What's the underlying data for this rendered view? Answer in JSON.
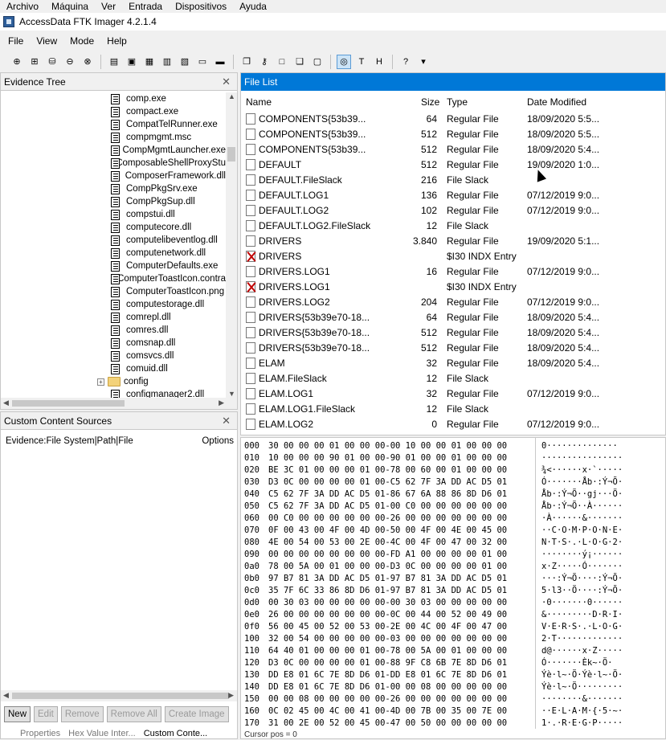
{
  "host_menu": [
    "Archivo",
    "Máquina",
    "Ver",
    "Entrada",
    "Dispositivos",
    "Ayuda"
  ],
  "window": {
    "title": "AccessData FTK Imager 4.2.1.4"
  },
  "menu": [
    "File",
    "View",
    "Mode",
    "Help"
  ],
  "toolbar_icons": [
    "add-evidence-icon",
    "add-all-evidence-icon",
    "image-mounting-icon",
    "remove-evidence-icon",
    "remove-all-icon",
    "create-disk-image-icon",
    "export-disk-image-icon",
    "export-logical-image-icon",
    "add-to-custom-icon",
    "create-custom-image-icon",
    "decrypt-icon",
    "verify-drive-icon",
    "export-files-icon",
    "export-hash-icon",
    "new-document-icon",
    "copy-icon",
    "print-icon",
    "auto-view-icon",
    "text-view-icon",
    "hex-view-icon",
    "help-icon",
    "dropdown-icon"
  ],
  "evidence_tree": {
    "title": "Evidence Tree",
    "items": [
      "comp.exe",
      "compact.exe",
      "CompatTelRunner.exe",
      "compmgmt.msc",
      "CompMgmtLauncher.exe",
      "ComposableShellProxyStu",
      "ComposerFramework.dll",
      "CompPkgSrv.exe",
      "CompPkgSup.dll",
      "compstui.dll",
      "computecore.dll",
      "computelibeventlog.dll",
      "computenetwork.dll",
      "ComputerDefaults.exe",
      "ComputerToastIcon.contra",
      "ComputerToastIcon.png",
      "computestorage.dll",
      "comrepl.dll",
      "comres.dll",
      "comsnap.dll",
      "comsvcs.dll",
      "comuid.dll"
    ],
    "folder": "config",
    "partial": "configmanager2.dll"
  },
  "custom_content": {
    "title": "Custom Content Sources",
    "col_evidence": "Evidence:File System|Path|File",
    "col_options": "Options",
    "buttons": [
      "New",
      "Edit",
      "Remove",
      "Remove All",
      "Create Image"
    ],
    "tabs": [
      "Properties",
      "Hex Value Inter...",
      "Custom Conte..."
    ]
  },
  "file_list": {
    "title": "File List",
    "columns": {
      "name": "Name",
      "size": "Size",
      "type": "Type",
      "date": "Date Modified"
    },
    "rows": [
      {
        "name": "COMPONENTS{53b39...",
        "size": "64",
        "type": "Regular File",
        "date": "18/09/2020 5:5...",
        "deleted": false
      },
      {
        "name": "COMPONENTS{53b39...",
        "size": "512",
        "type": "Regular File",
        "date": "18/09/2020 5:5...",
        "deleted": false
      },
      {
        "name": "COMPONENTS{53b39...",
        "size": "512",
        "type": "Regular File",
        "date": "18/09/2020 5:4...",
        "deleted": false
      },
      {
        "name": "DEFAULT",
        "size": "512",
        "type": "Regular File",
        "date": "19/09/2020 1:0...",
        "deleted": false
      },
      {
        "name": "DEFAULT.FileSlack",
        "size": "216",
        "type": "File Slack",
        "date": "",
        "deleted": false
      },
      {
        "name": "DEFAULT.LOG1",
        "size": "136",
        "type": "Regular File",
        "date": "07/12/2019 9:0...",
        "deleted": false
      },
      {
        "name": "DEFAULT.LOG2",
        "size": "102",
        "type": "Regular File",
        "date": "07/12/2019 9:0...",
        "deleted": false
      },
      {
        "name": "DEFAULT.LOG2.FileSlack",
        "size": "12",
        "type": "File Slack",
        "date": "",
        "deleted": false
      },
      {
        "name": "DRIVERS",
        "size": "3.840",
        "type": "Regular File",
        "date": "19/09/2020 5:1...",
        "deleted": false
      },
      {
        "name": "DRIVERS",
        "size": "",
        "type": "$I30 INDX Entry",
        "date": "",
        "deleted": true
      },
      {
        "name": "DRIVERS.LOG1",
        "size": "16",
        "type": "Regular File",
        "date": "07/12/2019 9:0...",
        "deleted": false
      },
      {
        "name": "DRIVERS.LOG1",
        "size": "",
        "type": "$I30 INDX Entry",
        "date": "",
        "deleted": true
      },
      {
        "name": "DRIVERS.LOG2",
        "size": "204",
        "type": "Regular File",
        "date": "07/12/2019 9:0...",
        "deleted": false
      },
      {
        "name": "DRIVERS{53b39e70-18...",
        "size": "64",
        "type": "Regular File",
        "date": "18/09/2020 5:4...",
        "deleted": false
      },
      {
        "name": "DRIVERS{53b39e70-18...",
        "size": "512",
        "type": "Regular File",
        "date": "18/09/2020 5:4...",
        "deleted": false
      },
      {
        "name": "DRIVERS{53b39e70-18...",
        "size": "512",
        "type": "Regular File",
        "date": "18/09/2020 5:4...",
        "deleted": false
      },
      {
        "name": "ELAM",
        "size": "32",
        "type": "Regular File",
        "date": "18/09/2020 5:4...",
        "deleted": false
      },
      {
        "name": "ELAM.FileSlack",
        "size": "12",
        "type": "File Slack",
        "date": "",
        "deleted": false
      },
      {
        "name": "ELAM.LOG1",
        "size": "32",
        "type": "Regular File",
        "date": "07/12/2019 9:0...",
        "deleted": false
      },
      {
        "name": "ELAM.LOG1.FileSlack",
        "size": "12",
        "type": "File Slack",
        "date": "",
        "deleted": false
      },
      {
        "name": "ELAM.LOG2",
        "size": "0",
        "type": "Regular File",
        "date": "07/12/2019 9:0...",
        "deleted": false
      }
    ]
  },
  "hex": {
    "rows": [
      {
        "off": "000",
        "bytes": "30 00 00 00 01 00 00 00-00 10 00 00 01 00 00 00",
        "ascii": "0··············"
      },
      {
        "off": "010",
        "bytes": "10 00 00 00 90 01 00 00-90 01 00 00 01 00 00 00",
        "ascii": "················"
      },
      {
        "off": "020",
        "bytes": "BE 3C 01 00 00 00 01 00-78 00 60 00 01 00 00 00",
        "ascii": "¾<······x·`·····"
      },
      {
        "off": "030",
        "bytes": "D3 0C 00 00 00 00 01 00-C5 62 7F 3A DD AC D5 01",
        "ascii": "Ó·······Åb·:Ý¬Õ·"
      },
      {
        "off": "040",
        "bytes": "C5 62 7F 3A DD AC D5 01-86 67 6A 88 86 8D D6 01",
        "ascii": "Åb·:Ý¬Õ··gj···Ö·"
      },
      {
        "off": "050",
        "bytes": "C5 62 7F 3A DD AC D5 01-00 C0 00 00 00 00 00 00",
        "ascii": "Åb·:Ý¬Õ··À······"
      },
      {
        "off": "060",
        "bytes": "00 C0 00 00 00 00 00 00-26 00 00 00 00 00 00 00",
        "ascii": "·À······&·······"
      },
      {
        "off": "070",
        "bytes": "0F 00 43 00 4F 00 4D 00-50 00 4F 00 4E 00 45 00",
        "ascii": "··C·O·M·P·O·N·E·"
      },
      {
        "off": "080",
        "bytes": "4E 00 54 00 53 00 2E 00-4C 00 4F 00 47 00 32 00",
        "ascii": "N·T·S·.·L·O·G·2·"
      },
      {
        "off": "090",
        "bytes": "00 00 00 00 00 00 00 00-FD A1 00 00 00 00 01 00",
        "ascii": "········ý¡······"
      },
      {
        "off": "0a0",
        "bytes": "78 00 5A 00 01 00 00 00-D3 0C 00 00 00 00 01 00",
        "ascii": "x·Z·····Ó·······"
      },
      {
        "off": "0b0",
        "bytes": "97 B7 81 3A DD AC D5 01-97 B7 81 3A DD AC D5 01",
        "ascii": "···:Ý¬Õ····:Ý¬Õ·"
      },
      {
        "off": "0c0",
        "bytes": "35 7F 6C 33 86 8D D6 01-97 B7 81 3A DD AC D5 01",
        "ascii": "5·l3··Ö····:Ý¬Õ·"
      },
      {
        "off": "0d0",
        "bytes": "00 30 03 00 00 00 00 00-00 30 03 00 00 00 00 00",
        "ascii": "·0·······0······"
      },
      {
        "off": "0e0",
        "bytes": "26 00 00 00 00 00 00 00-0C 00 44 00 52 00 49 00",
        "ascii": "&·········D·R·I·"
      },
      {
        "off": "0f0",
        "bytes": "56 00 45 00 52 00 53 00-2E 00 4C 00 4F 00 47 00",
        "ascii": "V·E·R·S·.·L·O·G·"
      },
      {
        "off": "100",
        "bytes": "32 00 54 00 00 00 00 00-03 00 00 00 00 00 00 00",
        "ascii": "2·T·············"
      },
      {
        "off": "110",
        "bytes": "64 40 01 00 00 00 01 00-78 00 5A 00 01 00 00 00",
        "ascii": "d@······x·Z·····"
      },
      {
        "off": "120",
        "bytes": "D3 0C 00 00 00 00 01 00-88 9F C8 6B 7E 8D D6 01",
        "ascii": "Ó·······Èk~·Ö·"
      },
      {
        "off": "130",
        "bytes": "DD E8 01 6C 7E 8D D6 01-DD E8 01 6C 7E 8D D6 01",
        "ascii": "Ýè·l~·Ö·Ýè·l~·Ö·"
      },
      {
        "off": "140",
        "bytes": "DD E8 01 6C 7E 8D D6 01-00 00 08 00 00 00 00 00",
        "ascii": "Ýè·l~·Ö·········"
      },
      {
        "off": "150",
        "bytes": "00 00 08 00 00 00 00 00-26 00 00 00 00 00 00 00",
        "ascii": "········&·······"
      },
      {
        "off": "160",
        "bytes": "0C 02 45 00 4C 00 41 00-4D 00 7B 00 35 00 7E 00",
        "ascii": "··E·L·A·M·{·5·~·"
      },
      {
        "off": "170",
        "bytes": "31 00 2E 00 52 00 45 00-47 00 50 00 00 00 00 00",
        "ascii": "1·.·R·E·G·P·····"
      }
    ],
    "status": "Cursor pos = 0"
  }
}
